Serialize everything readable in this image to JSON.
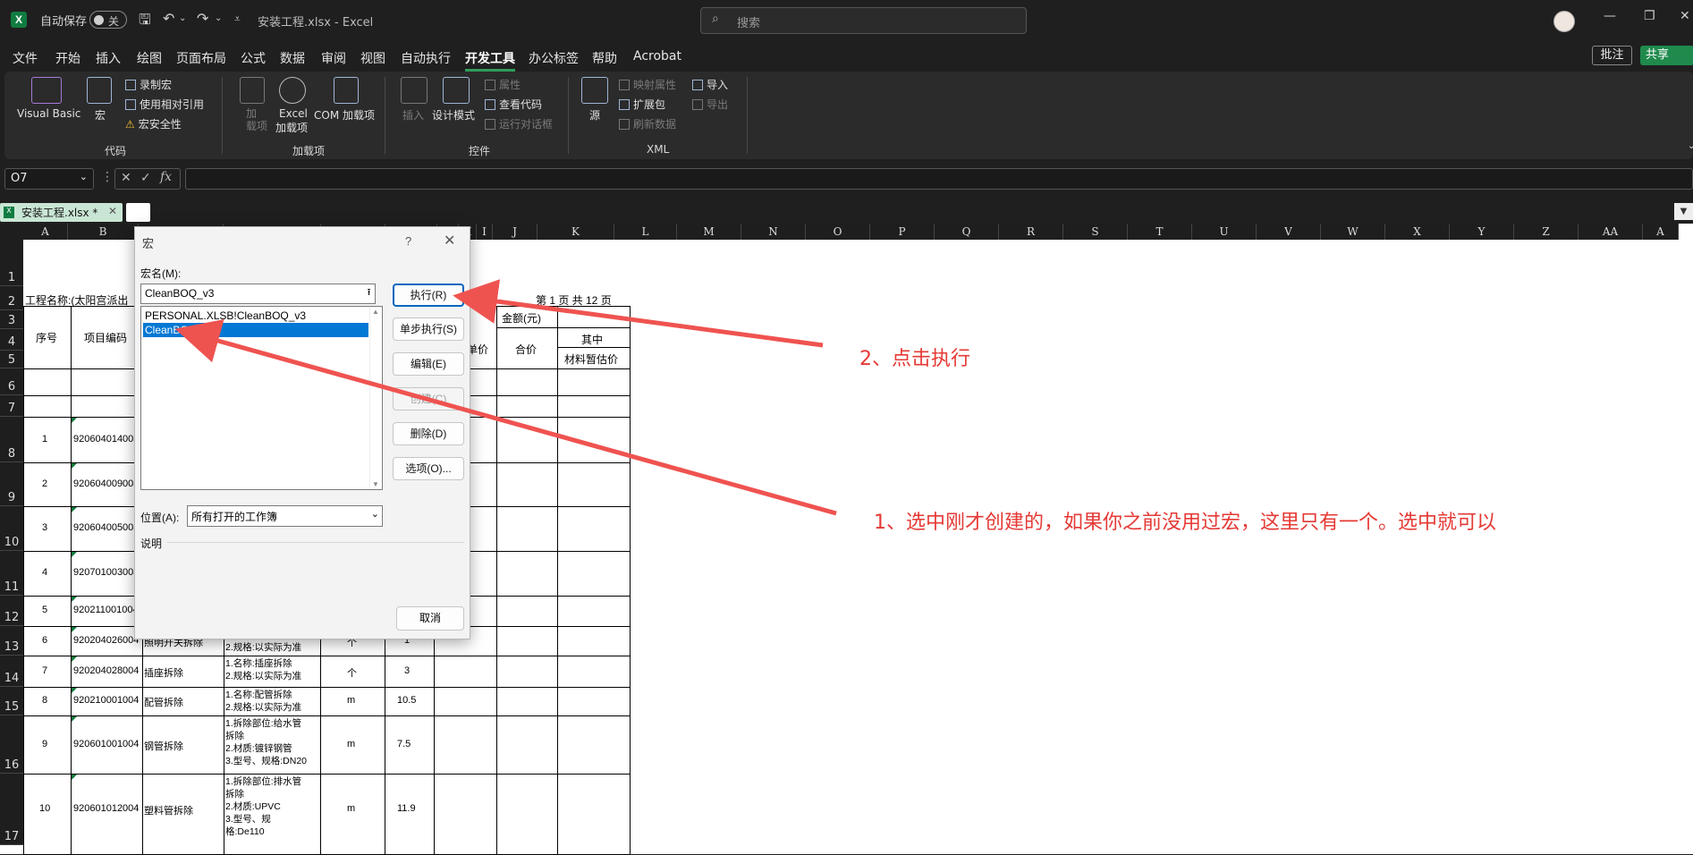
{
  "titlebar": {
    "autosave_label": "自动保存",
    "autosave_state": "关",
    "doc_title": "安装工程.xlsx  -  Excel",
    "search_placeholder": "搜索",
    "app_icon": "X"
  },
  "menu": [
    "文件",
    "开始",
    "插入",
    "绘图",
    "页面布局",
    "公式",
    "数据",
    "审阅",
    "视图",
    "自动执行",
    "开发工具",
    "办公标签",
    "帮助",
    "Acrobat"
  ],
  "menu_active": "开发工具",
  "header_buttons": {
    "comment": "批注",
    "share": "共享"
  },
  "ribbon": {
    "code": {
      "visual_basic": "Visual Basic",
      "macros": "宏",
      "record_macro": "录制宏",
      "relative_ref": "使用相对引用",
      "macro_security": "宏安全性",
      "group": "代码"
    },
    "addins": {
      "addins": "加\n载项",
      "excel_addins_1": "Excel",
      "excel_addins_2": "加载项",
      "com_addins": "COM 加载项",
      "group": "加载项"
    },
    "controls": {
      "insert": "插入",
      "design_mode": "设计模式",
      "properties": "属性",
      "view_code": "查看代码",
      "run_dialog": "运行对话框",
      "group": "控件"
    },
    "xml": {
      "source": "源",
      "map_props": "映射属性",
      "expansion": "扩展包",
      "refresh": "刷新数据",
      "import": "导入",
      "export": "导出",
      "group": "XML"
    }
  },
  "formula_bar": {
    "name_box": "O7",
    "fx": "fx"
  },
  "tabs": {
    "file_tab": "安装工程.xlsx *"
  },
  "columns": [
    "A",
    "B",
    "C",
    "D",
    "E",
    "F",
    "G",
    "H",
    "I",
    "J",
    "K",
    "L",
    "M",
    "N",
    "O",
    "P",
    "Q",
    "R",
    "S",
    "T",
    "U",
    "V",
    "W",
    "X",
    "Y",
    "Z",
    "AA",
    "A"
  ],
  "rows": [
    "1",
    "2",
    "3",
    "4",
    "5",
    "6",
    "7",
    "8",
    "9",
    "10",
    "11",
    "12",
    "13",
    "14",
    "15",
    "16",
    "17"
  ],
  "sheet": {
    "project_name": "工程名称:(太阳宫派出",
    "page_info": "第 1 页  共 12 页",
    "hdr_seq": "序号",
    "hdr_code": "项目编码",
    "hdr_amount": "金额(元)",
    "hdr_unit_price": "单价",
    "hdr_total": "合价",
    "hdr_among": "其中",
    "hdr_material": "材料暂估价",
    "rows": [
      {
        "seq": "1",
        "code": "920604014003"
      },
      {
        "seq": "2",
        "code": "920604009003"
      },
      {
        "seq": "3",
        "code": "920604005003"
      },
      {
        "seq": "4",
        "code": "920701003003"
      },
      {
        "seq": "5",
        "code": "920211001004"
      },
      {
        "seq": "6",
        "code": "920204026004",
        "name": "照明开关拆除",
        "desc": "2.规格:以实际为准",
        "unit": "个",
        "qty": "1"
      },
      {
        "seq": "7",
        "code": "920204028004",
        "name": "插座拆除",
        "desc": "1.名称:插座拆除\n2.规格:以实际为准",
        "unit": "个",
        "qty": "3"
      },
      {
        "seq": "8",
        "code": "920210001004",
        "name": "配管拆除",
        "desc": "1.名称:配管拆除\n2.规格:以实际为准",
        "unit": "m",
        "qty": "10.5"
      },
      {
        "seq": "9",
        "code": "920601001004",
        "name": "钢管拆除",
        "desc": "1.拆除部位:给水管\n拆除\n2.材质:镀锌钢管\n3.型号、规格:DN20",
        "unit": "m",
        "qty": "7.5"
      },
      {
        "seq": "10",
        "code": "920601012004",
        "name": "塑料管拆除",
        "desc": "1.拆除部位:排水管\n拆除\n2.材质:UPVC\n3.型号、规\n格:De110",
        "unit": "m",
        "qty": "11.9"
      }
    ]
  },
  "dialog": {
    "title": "宏",
    "help": "?",
    "macro_name_label": "宏名(M):",
    "macro_name_value": "CleanBOQ_v3",
    "list": [
      "PERSONAL.XLSB!CleanBOQ_v3",
      "CleanBOQ_v3"
    ],
    "selected_index": 1,
    "buttons": [
      "执行(R)",
      "单步执行(S)",
      "编辑(E)",
      "创建(C)",
      "删除(D)",
      "选项(O)..."
    ],
    "location_label": "位置(A):",
    "location_value": "所有打开的工作簿",
    "description_label": "说明",
    "cancel": "取消"
  },
  "annotations": {
    "step2": "2、点击执行",
    "step1": "1、选中刚才创建的，如果你之前没用过宏，这里只有一个。选中就可以"
  },
  "colors": {
    "accent": "#2e9d5b",
    "arrow": "#ef5350",
    "select": "#0078d4"
  }
}
